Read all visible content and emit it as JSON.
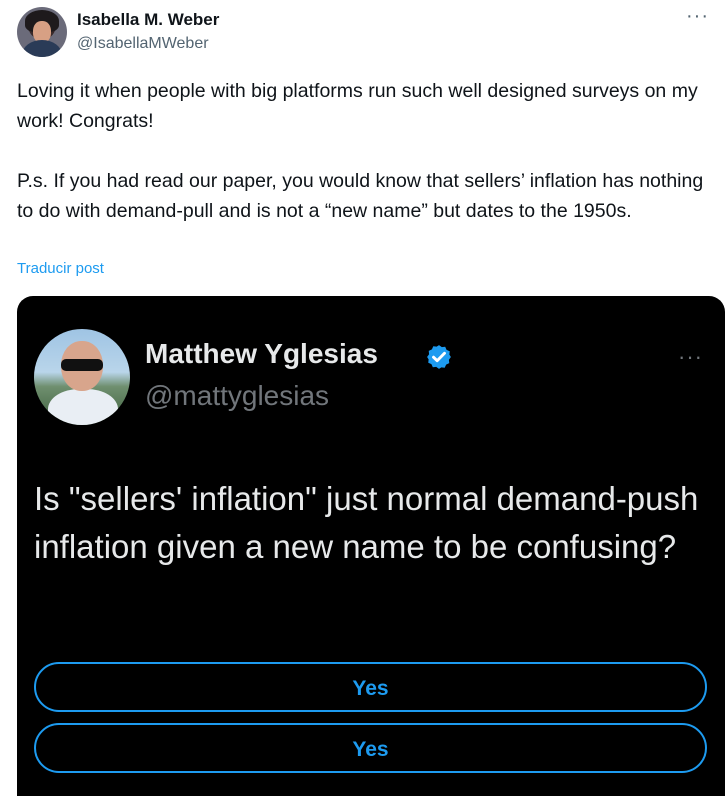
{
  "tweet": {
    "author_name": "Isabella M. Weber",
    "author_handle": "@IsabellaMWeber",
    "body": "Loving it when people with big platforms run such well designed surveys on my work! Congrats!\n\nP.s. If you had read our paper, you would know that sellers’ inflation has nothing to do with demand-pull and is not a “new name” but dates to the 1950s.",
    "translate_label": "Traducir post",
    "more_icon": "···"
  },
  "quoted": {
    "author_name": "Matthew Yglesias",
    "author_handle": "@mattyglesias",
    "more_icon": "···",
    "question": "Is \"sellers' inflation\" just normal demand-push inflation given a new name to be confusing?",
    "options": [
      "Yes",
      "Yes"
    ],
    "verified_color": "#1d9bf0"
  }
}
